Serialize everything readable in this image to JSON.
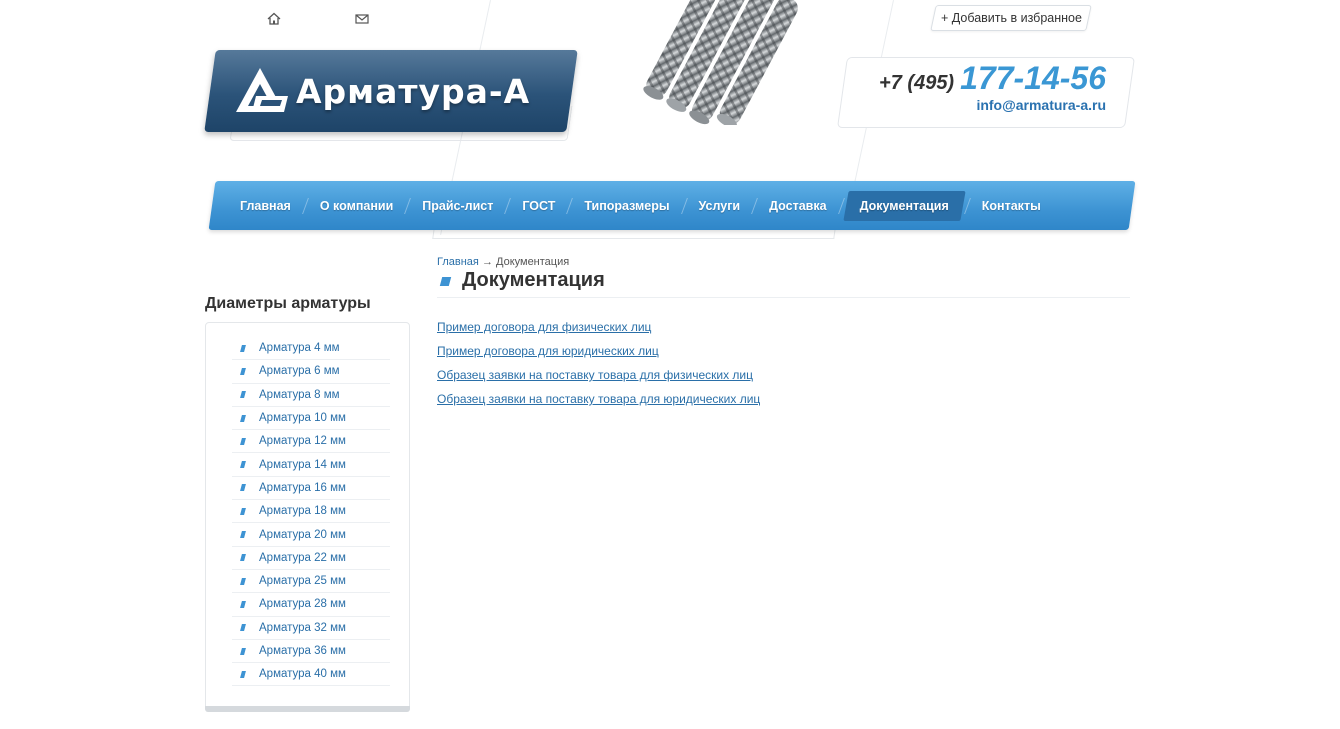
{
  "header": {
    "favorites_label": "+ Добавить в избранное",
    "logo_text": "Арматура-А",
    "phone_code": "+7 (495)",
    "phone_number": "177-14-56",
    "email": "info@armatura-a.ru"
  },
  "nav": {
    "items": [
      {
        "label": "Главная"
      },
      {
        "label": "О компании"
      },
      {
        "label": "Прайс-лист"
      },
      {
        "label": "ГОСТ"
      },
      {
        "label": "Типоразмеры"
      },
      {
        "label": "Услуги"
      },
      {
        "label": "Доставка"
      },
      {
        "label": "Документация"
      },
      {
        "label": "Контакты"
      }
    ],
    "active": "Документация"
  },
  "sidebar": {
    "title": "Диаметры арматуры",
    "items": [
      {
        "label": "Арматура 4 мм"
      },
      {
        "label": "Арматура 6 мм"
      },
      {
        "label": "Арматура 8 мм"
      },
      {
        "label": "Арматура 10 мм"
      },
      {
        "label": "Арматура 12 мм"
      },
      {
        "label": "Арматура 14 мм"
      },
      {
        "label": "Арматура 16 мм"
      },
      {
        "label": "Арматура 18 мм"
      },
      {
        "label": "Арматура 20 мм"
      },
      {
        "label": "Арматура 22 мм"
      },
      {
        "label": "Арматура 25 мм"
      },
      {
        "label": "Арматура 28 мм"
      },
      {
        "label": "Арматура 32 мм"
      },
      {
        "label": "Арматура 36 мм"
      },
      {
        "label": "Арматура 40 мм"
      }
    ]
  },
  "breadcrumb": {
    "home": "Главная",
    "separator": "→",
    "current": "Документация"
  },
  "main": {
    "title": "Документация",
    "links": [
      {
        "label": "Пример договора для физических лиц"
      },
      {
        "label": "Пример договора для юридических лиц"
      },
      {
        "label": "Образец заявки на поставку товара для физических лиц"
      },
      {
        "label": "Образец заявки на поставку товара для юридических лиц"
      }
    ]
  },
  "icons": {
    "home": "home-icon",
    "mail": "mail-icon"
  },
  "colors": {
    "accent": "#3d93d3",
    "link": "#2a6fa8",
    "logo_bg": "#2b5379"
  }
}
